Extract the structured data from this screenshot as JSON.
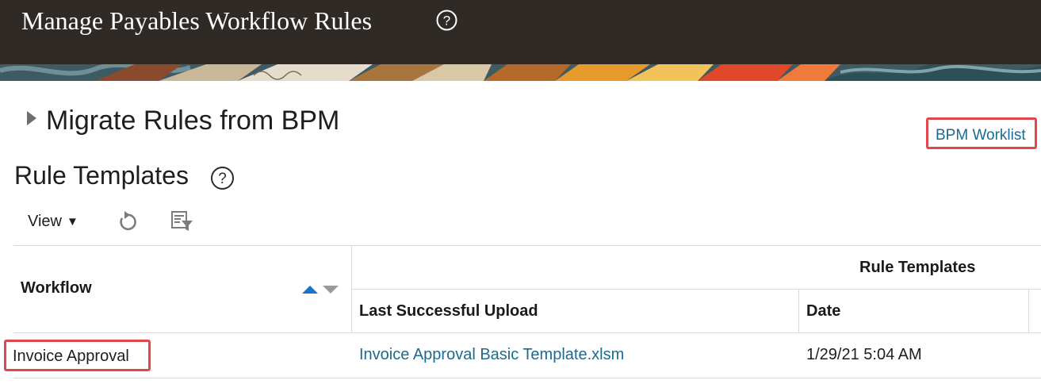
{
  "header": {
    "title": "Manage Payables Workflow Rules",
    "help_icon": "question-circle-icon",
    "bar_color": "#2f2a25"
  },
  "migrate_section": {
    "title": "Migrate Rules from BPM",
    "expand_icon": "disclosure-triangle-right-icon"
  },
  "bpm_worklist": {
    "label": "BPM Worklist"
  },
  "rule_templates": {
    "heading": "Rule Templates",
    "help_icon": "question-circle-icon"
  },
  "toolbar": {
    "view_label": "View",
    "refresh_icon": "refresh-icon",
    "filter_icon": "query-by-example-icon"
  },
  "table": {
    "header_workflow": "Workflow",
    "header_group": "Rule Templates",
    "header_last_upload": "Last Successful Upload",
    "header_date": "Date",
    "rows": [
      {
        "workflow": "Invoice Approval",
        "last_upload": "Invoice Approval Basic Template.xlsm",
        "date": "1/29/21 5:04 AM"
      }
    ]
  },
  "colors": {
    "link": "#1d6a8e",
    "highlight_box": "#e0484d",
    "sort_ascending_active": "#1a73c9"
  }
}
